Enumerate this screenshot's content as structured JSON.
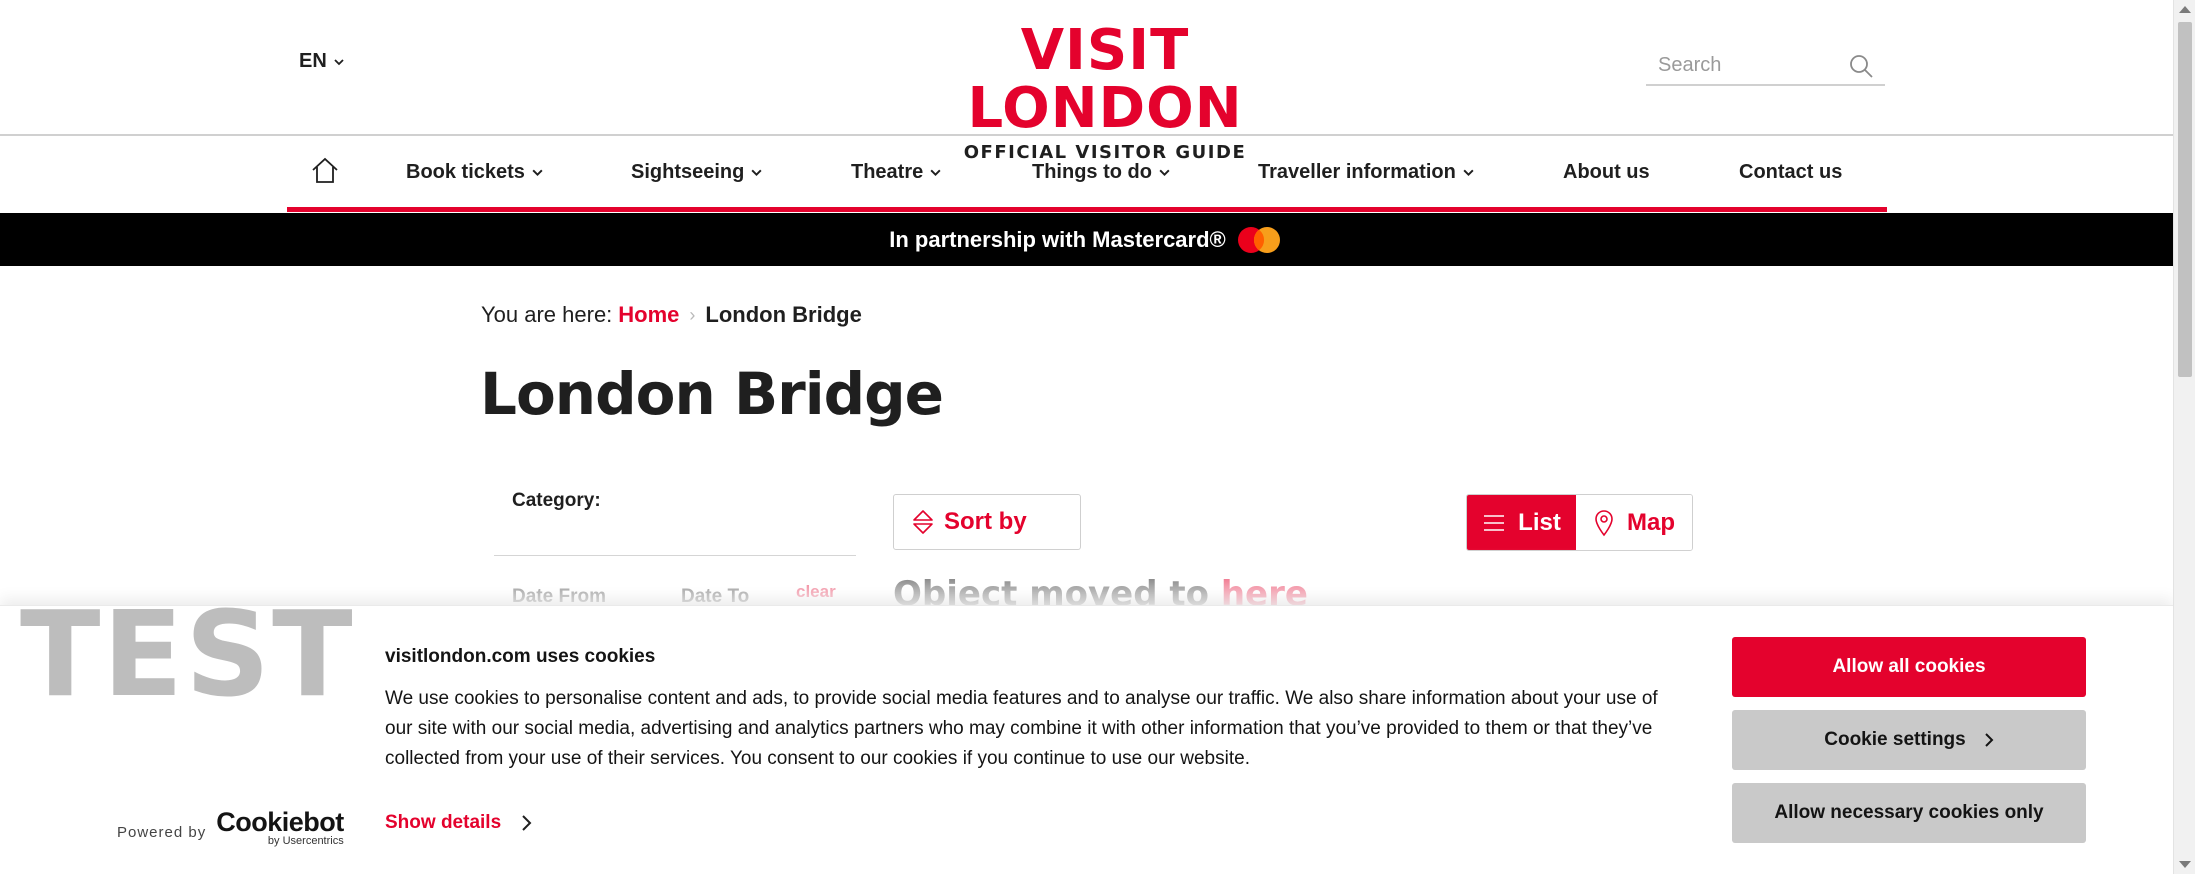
{
  "header": {
    "language": "EN",
    "logo_title": "VISIT LONDON",
    "logo_subtitle": "OFFICIAL VISITOR GUIDE",
    "search_placeholder": "Search"
  },
  "nav": {
    "items": [
      {
        "label": "Book tickets",
        "dropdown": true
      },
      {
        "label": "Sightseeing",
        "dropdown": true
      },
      {
        "label": "Theatre",
        "dropdown": true
      },
      {
        "label": "Things to do",
        "dropdown": true
      },
      {
        "label": "Traveller information",
        "dropdown": true
      },
      {
        "label": "About us",
        "dropdown": false
      },
      {
        "label": "Contact us",
        "dropdown": false
      }
    ]
  },
  "partner_bar": {
    "text": "In partnership with Mastercard®"
  },
  "breadcrumb": {
    "prefix": "You are here:",
    "home": "Home",
    "current": "London Bridge"
  },
  "page": {
    "title": "London Bridge"
  },
  "filters": {
    "category_label": "Category:",
    "date_from_label": "Date From",
    "date_to_label": "Date To",
    "clear_label": "clear"
  },
  "results": {
    "sort_label": "Sort by",
    "view_list_label": "List",
    "view_map_label": "Map",
    "active_view": "List",
    "moved_text": "Object moved to",
    "moved_link": "here"
  },
  "cookie": {
    "watermark": "TEST",
    "title": "visitlondon.com uses cookies",
    "body": "We use cookies to personalise content and ads, to provide social media features and to analyse our traffic. We also share information about your use of our site with our social media, advertising and analytics partners who may combine it with other information that you’ve provided to them or that they’ve collected from your use of their services. You consent to our cookies if you continue to use our website.",
    "show_details": "Show details",
    "powered_by": "Powered by",
    "cookiebot_name": "Cookiebot",
    "cookiebot_by": "by Usercentrics",
    "allow_all": "Allow all cookies",
    "settings": "Cookie settings",
    "necessary_only": "Allow necessary cookies only"
  },
  "colors": {
    "brand_red": "#e4022d",
    "dark_text": "#1f1f1f",
    "partner_bar_bg": "#000000",
    "secondary_button": "#c9c9c9",
    "watermark": "#bdbdbd"
  }
}
